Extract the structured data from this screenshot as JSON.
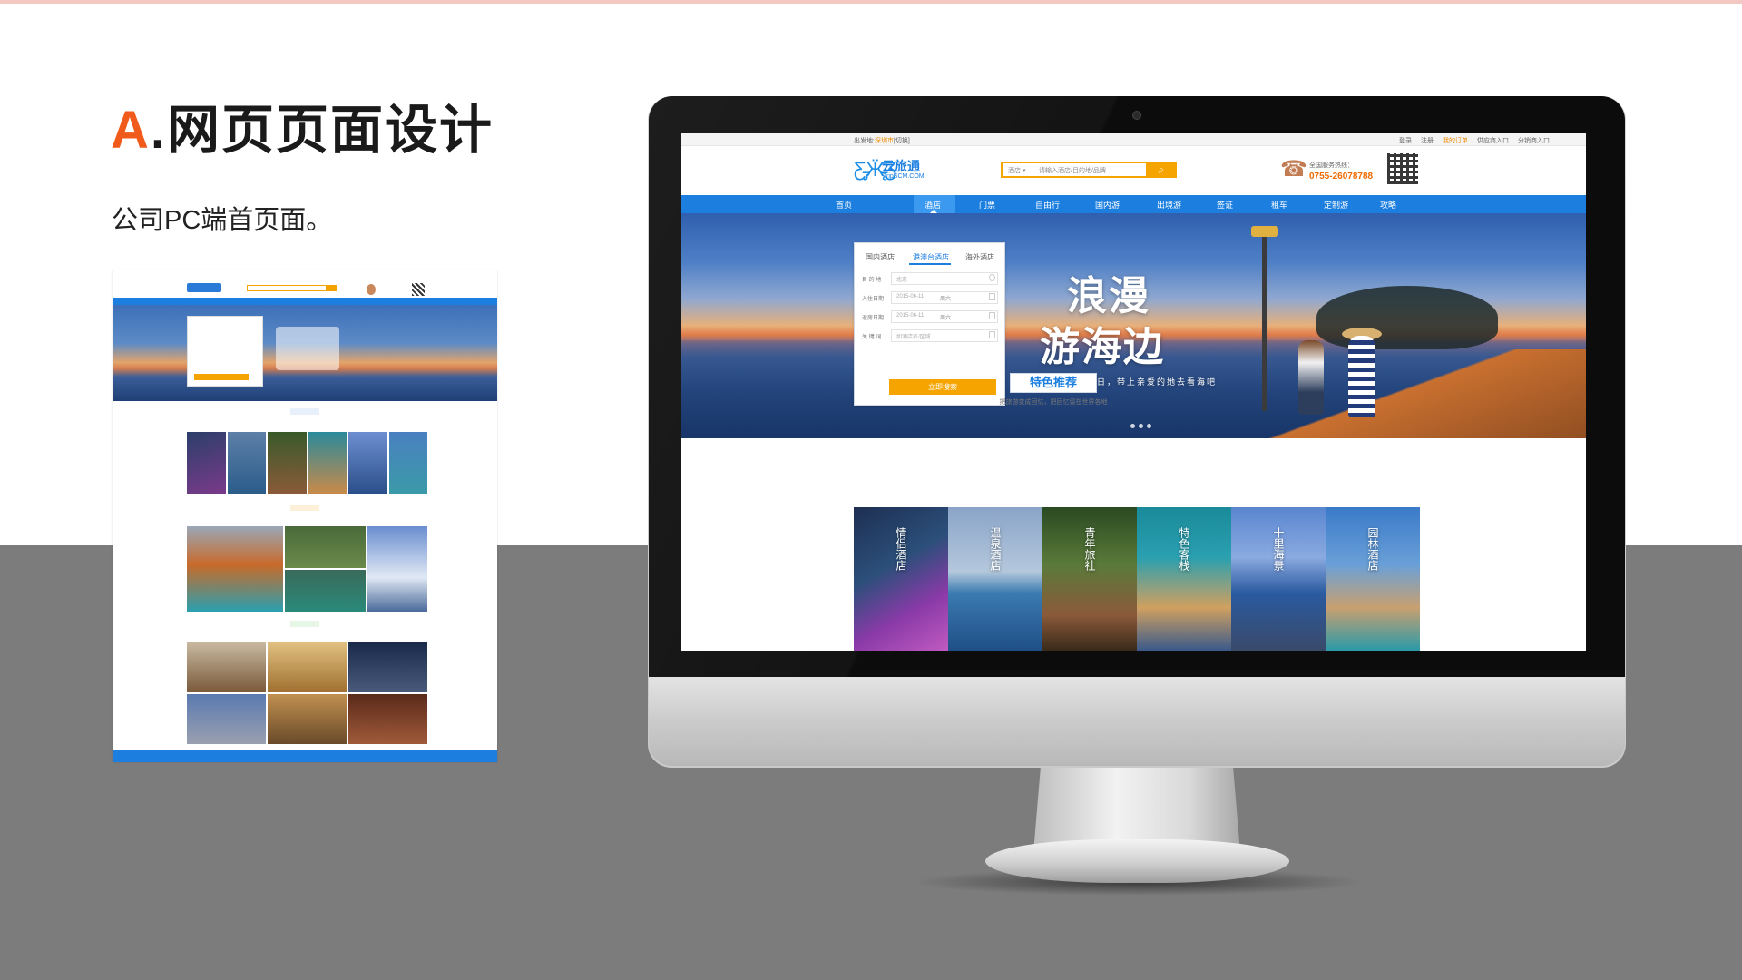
{
  "slide": {
    "title_letter": "A",
    "title_rest": ".网页页面设计",
    "subtitle": "公司PC端首页面。"
  },
  "colors": {
    "accent_orange": "#f05a1a",
    "brand_blue": "#1c7fe0",
    "button_orange": "#f5a400",
    "gray_band": "#7c7c7c"
  },
  "site": {
    "topbar": {
      "location_label": "出发地:",
      "location_value": "深圳市",
      "location_switch": "[切换]",
      "links": [
        "登录",
        "注册",
        "我的订单",
        "供应商入口",
        "分销商入口"
      ]
    },
    "logo": {
      "icon": "butterfly-logo-icon",
      "name": "云旅通",
      "domain": "TripSCM.COM"
    },
    "search": {
      "category": "酒店",
      "placeholder": "请输入酒店/目的地/品牌",
      "button_icon": "search-icon"
    },
    "service": {
      "label": "全国服务热线：",
      "phone": "0755-26078788"
    },
    "nav": [
      "首页",
      "酒店",
      "门票",
      "自由行",
      "国内游",
      "出境游",
      "签证",
      "租车",
      "定制游",
      "攻略"
    ],
    "nav_active_index": 1,
    "banner": {
      "slogan_line1": "浪漫",
      "slogan_line2": "游海边",
      "slogan_sub": "浪漫夏日，带上亲爱的她去看海吧",
      "slides": 3
    },
    "booking": {
      "tabs": [
        "国内酒店",
        "港澳台酒店",
        "海外酒店"
      ],
      "active_tab": 1,
      "destination_label": "目 的 地",
      "destination_value": "北京",
      "checkin_label": "入住日期",
      "checkin_value": "2015-06-11",
      "checkin_day": "周六",
      "checkout_label": "退房日期",
      "checkout_value": "2015-06-11",
      "checkout_day": "周六",
      "keyword_label": "关 键 词",
      "keyword_placeholder": "如酒店名/区域",
      "submit": "立即搜索"
    },
    "featured": {
      "title": "特色推荐",
      "subtitle": "把旅游变成回忆，把回忆留在世界各地",
      "tiles": [
        "情侣酒店",
        "温泉酒店",
        "青年旅社",
        "特色客栈",
        "十里海景",
        "园林酒店"
      ]
    }
  }
}
